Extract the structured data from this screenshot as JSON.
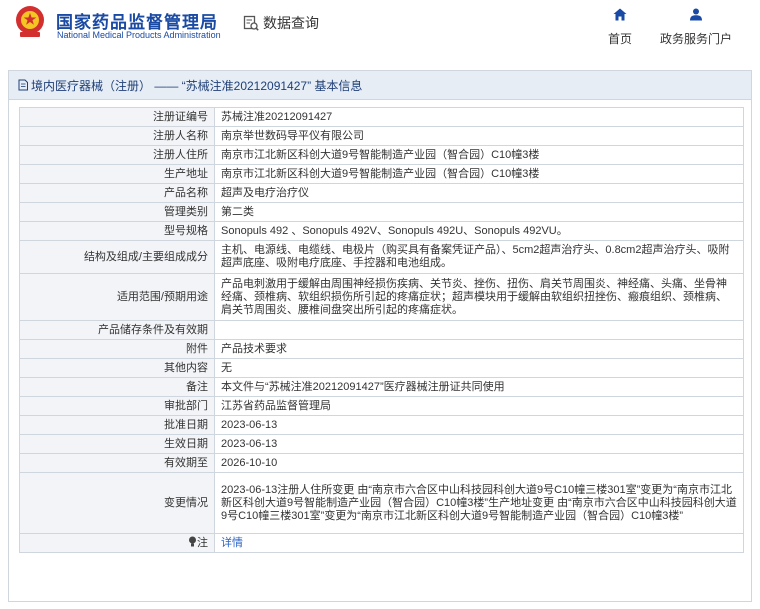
{
  "header": {
    "site_name_cn": "国家药品监督管理局",
    "site_name_en": "National Medical Products Administration",
    "search_label": "数据查询",
    "home_label": "首页",
    "portal_label": "政务服务门户"
  },
  "panel": {
    "title": "境内医疗器械（注册） —— “苏械注准20212091427” 基本信息"
  },
  "rows": [
    {
      "key": "注册证编号",
      "value": "苏械注准20212091427"
    },
    {
      "key": "注册人名称",
      "value": "南京举世数码导平仪有限公司"
    },
    {
      "key": "注册人住所",
      "value": "南京市江北新区科创大道9号智能制造产业园（智合园）C10幢3楼"
    },
    {
      "key": "生产地址",
      "value": "南京市江北新区科创大道9号智能制造产业园（智合园）C10幢3楼"
    },
    {
      "key": "产品名称",
      "value": "超声及电疗治疗仪"
    },
    {
      "key": "管理类别",
      "value": "第二类"
    },
    {
      "key": "型号规格",
      "value": "Sonopuls 492 、Sonopuls 492V、Sonopuls 492U、Sonopuls 492VU。"
    },
    {
      "key": "结构及组成/主要组成成分",
      "value": "主机、电源线、电缆线、电极片（购买具有备案凭证产品）、5cm2超声治疗头、0.8cm2超声治疗头、吸附超声底座、吸附电疗底座、手控器和电池组成。"
    },
    {
      "key": "适用范围/预期用途",
      "value": "产品电刺激用于缓解由周围神经损伤疾病、关节炎、挫伤、扭伤、肩关节周围炎、神经痛、头痛、坐骨神经痛、颈椎病、软组织损伤所引起的疼痛症状；超声模块用于缓解由软组织扭挫伤、瘢痕组织、颈椎病、肩关节周围炎、腰椎间盘突出所引起的疼痛症状。"
    },
    {
      "key": "产品储存条件及有效期",
      "value": ""
    },
    {
      "key": "附件",
      "value": "产品技术要求"
    },
    {
      "key": "其他内容",
      "value": "无"
    },
    {
      "key": "备注",
      "value": "本文件与“苏械注准20212091427”医疗器械注册证共同使用"
    },
    {
      "key": "审批部门",
      "value": "江苏省药品监督管理局"
    },
    {
      "key": "批准日期",
      "value": "2023-06-13"
    },
    {
      "key": "生效日期",
      "value": "2023-06-13"
    },
    {
      "key": "有效期至",
      "value": "2026-10-10"
    },
    {
      "key": "变更情况",
      "value": "2023-06-13注册人住所变更 由“南京市六合区中山科技园科创大道9号C10幢三楼301室”变更为“南京市江北新区科创大道9号智能制造产业园（智合园）C10幢3楼”生产地址变更 由“南京市六合区中山科技园科创大道9号C10幢三楼301室”变更为“南京市江北新区科创大道9号智能制造产业园（智合园）C10幢3楼”"
    }
  ],
  "note": {
    "key": "注",
    "link": "详情"
  }
}
